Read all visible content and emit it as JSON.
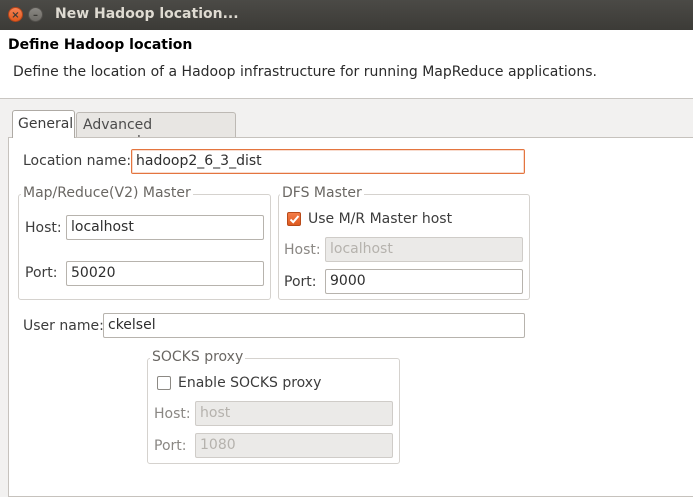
{
  "window": {
    "title": "New Hadoop location..."
  },
  "header": {
    "title": "Define Hadoop location",
    "description": "Define the location of a Hadoop infrastructure for running MapReduce applications."
  },
  "tabs": [
    {
      "label": "General",
      "active": true
    },
    {
      "label": "Advanced parameters",
      "active": false
    }
  ],
  "general": {
    "location_name_label": "Location name:",
    "location_name_value": "hadoop2_6_3_dist",
    "mr_master": {
      "legend": "Map/Reduce(V2) Master",
      "host_label": "Host:",
      "host_value": "localhost",
      "port_label": "Port:",
      "port_value": "50020"
    },
    "dfs_master": {
      "legend": "DFS Master",
      "use_mr_label": "Use M/R Master host",
      "use_mr_checked": true,
      "host_label": "Host:",
      "host_value": "localhost",
      "port_label": "Port:",
      "port_value": "9000"
    },
    "user_name_label": "User name:",
    "user_name_value": "ckelsel",
    "socks": {
      "legend": "SOCKS proxy",
      "enable_label": "Enable SOCKS proxy",
      "enable_checked": false,
      "host_label": "Host:",
      "host_value": "host",
      "port_label": "Port:",
      "port_value": "1080"
    }
  },
  "colors": {
    "accent": "#e4753f",
    "titlebar": "#3c3b37"
  }
}
